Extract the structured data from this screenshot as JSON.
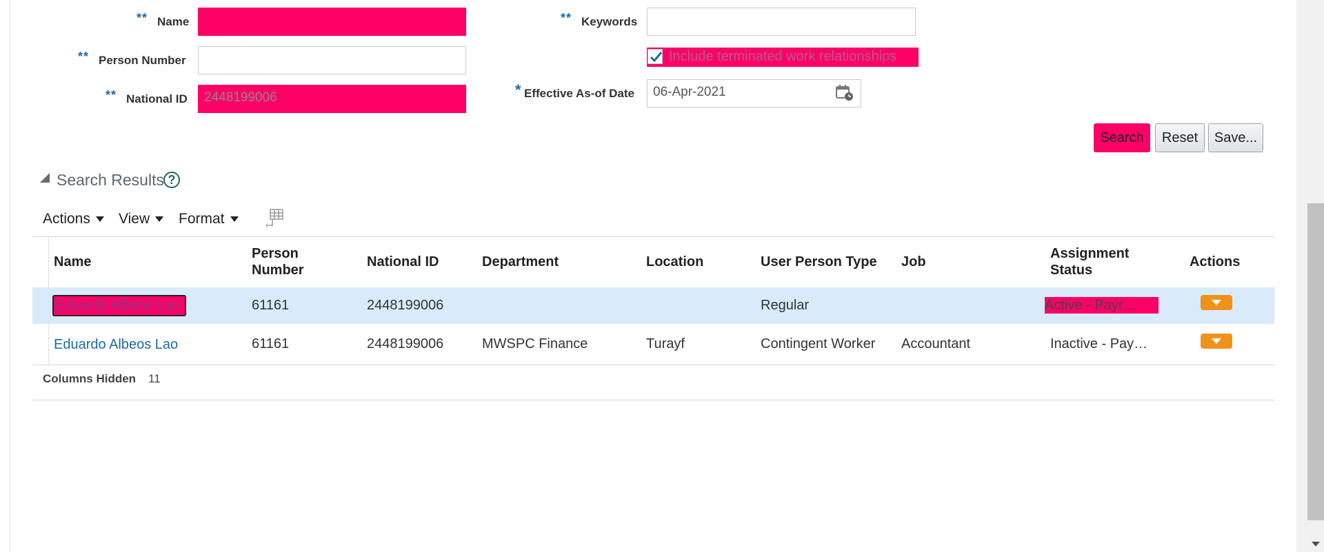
{
  "form": {
    "name": {
      "required_marker": "**",
      "label": "Name",
      "value": ""
    },
    "person_number": {
      "required_marker": "**",
      "label": "Person Number",
      "value": ""
    },
    "national_id": {
      "required_marker": "**",
      "label": "National ID",
      "value": "2448199006"
    },
    "keywords": {
      "required_marker": "**",
      "label": "Keywords",
      "value": ""
    },
    "include_terminated": {
      "label": "Include terminated work relationships",
      "checked": true
    },
    "effective_date": {
      "required_marker": "*",
      "label": "Effective As-of Date",
      "value": "06-Apr-2021"
    }
  },
  "buttons": {
    "search": "Search",
    "reset": "Reset",
    "save": "Save..."
  },
  "results": {
    "title": "Search Results",
    "help_glyph": "?",
    "toolbar": {
      "actions": "Actions",
      "view": "View",
      "format": "Format"
    },
    "headers": {
      "name": "Name",
      "person_number": "Person Number",
      "national_id": "National ID",
      "department": "Department",
      "location": "Location",
      "user_person_type": "User Person Type",
      "job": "Job",
      "assignment_status": "Assignment Status",
      "actions": "Actions"
    },
    "rows": [
      {
        "name": "Eduardo Albeos Lao",
        "person_number": "61161",
        "national_id": "2448199006",
        "department": "",
        "location": "",
        "user_person_type": "Regular",
        "job": "",
        "assignment_status": "Active - Payr…",
        "selected": true
      },
      {
        "name": "Eduardo Albeos Lao",
        "person_number": "61161",
        "national_id": "2448199006",
        "department": "MWSPC Finance",
        "location": "Turayf",
        "user_person_type": "Contingent Worker",
        "job": "Accountant",
        "assignment_status": "Inactive - Pay…",
        "selected": false
      }
    ],
    "footer": {
      "label": "Columns Hidden",
      "count": "11"
    }
  },
  "colors": {
    "highlight": "#ff0066",
    "link": "#1a6aa8",
    "action_button": "#f0921a",
    "selected_row": "#d9ebfb"
  }
}
